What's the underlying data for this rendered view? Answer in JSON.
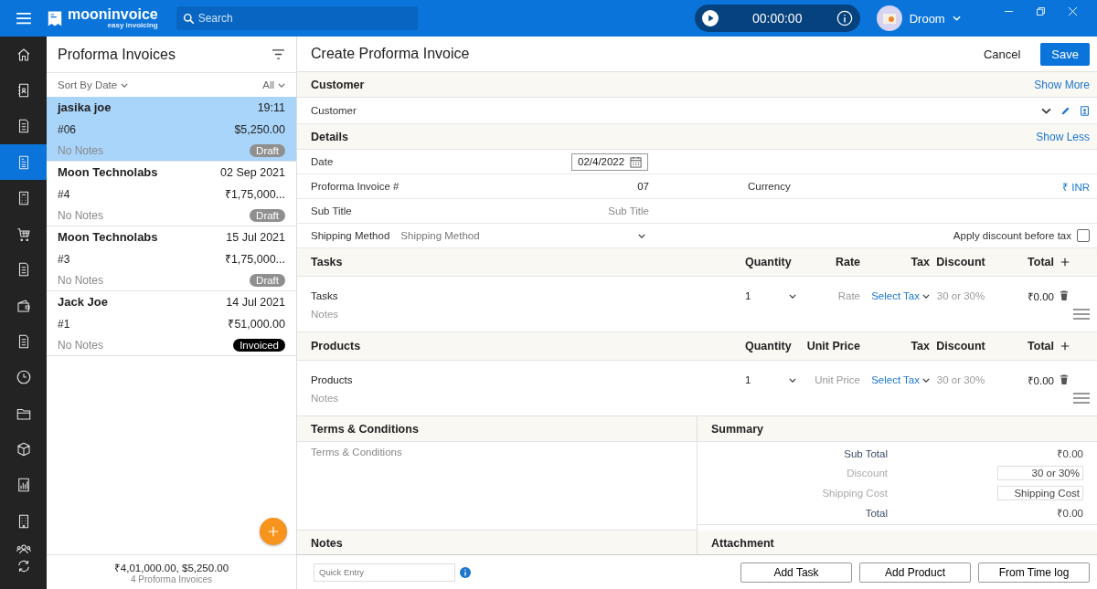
{
  "app": {
    "brand": "mooninvoice",
    "tagline": "easy invoicing",
    "search_placeholder": "Search",
    "timer": "00:00:00",
    "user": "Droom"
  },
  "sidebar": {
    "items": [
      {
        "selected": false
      },
      {
        "selected": false
      },
      {
        "selected": false
      },
      {
        "selected": true
      },
      {
        "selected": false
      },
      {
        "selected": false
      },
      {
        "selected": false
      },
      {
        "selected": false
      },
      {
        "selected": false
      },
      {
        "selected": false
      },
      {
        "selected": false
      },
      {
        "selected": false
      },
      {
        "selected": false
      },
      {
        "selected": false
      },
      {
        "selected": false
      },
      {
        "selected": false
      }
    ]
  },
  "list": {
    "title": "Proforma Invoices",
    "sort": "Sort By Date",
    "filter": "All",
    "items": [
      {
        "name": "jasika joe",
        "date": "19:11",
        "number": "#06",
        "amount": "$5,250.00",
        "notes": "No Notes",
        "status": "Draft",
        "kind": "draft",
        "selected": true
      },
      {
        "name": "Moon Technolabs",
        "date": "02 Sep 2021",
        "number": "#4",
        "amount": "₹1,75,000...",
        "notes": "No Notes",
        "status": "Draft",
        "kind": "draft",
        "selected": false
      },
      {
        "name": "Moon Technolabs",
        "date": "15 Jul 2021",
        "number": "#3",
        "amount": "₹1,75,000...",
        "notes": "No Notes",
        "status": "Draft",
        "kind": "draft",
        "selected": false
      },
      {
        "name": "Jack Joe",
        "date": "14 Jul 2021",
        "number": "#1",
        "amount": "₹51,000.00",
        "notes": "No Notes",
        "status": "Invoiced",
        "kind": "invoiced",
        "selected": false
      }
    ],
    "totals": "₹4,01,000.00, $5,250.00",
    "count": "4 Proforma Invoices"
  },
  "form": {
    "title": "Create Proforma Invoice",
    "cancel": "Cancel",
    "save": "Save",
    "customer": {
      "heading": "Customer",
      "toggle": "Show More",
      "placeholder": "Customer"
    },
    "details": {
      "heading": "Details",
      "toggle": "Show Less",
      "date_label": "Date",
      "date": "02/4/2022",
      "number_label": "Proforma Invoice #",
      "number": "07",
      "currency_label": "Currency",
      "currency": "₹ INR",
      "subtitle_label": "Sub Title",
      "subtitle_placeholder": "Sub Title",
      "shipping_label": "Shipping Method",
      "shipping_placeholder": "Shipping Method",
      "discount_label": "Apply discount before tax",
      "discount_before_tax": false
    },
    "sections": [
      {
        "heading": "Tasks",
        "columns": [
          "Quantity",
          "Rate",
          "Tax",
          "Discount",
          "Total"
        ],
        "row": {
          "name": "Tasks",
          "quantity": "1",
          "price_placeholder": "Rate",
          "tax": "Select Tax",
          "discount_placeholder": "30 or 30%",
          "total": "₹0.00",
          "notes_placeholder": "Notes"
        }
      },
      {
        "heading": "Products",
        "columns": [
          "Quantity",
          "Unit Price",
          "Tax",
          "Discount",
          "Total"
        ],
        "row": {
          "name": "Products",
          "quantity": "1",
          "price_placeholder": "Unit Price",
          "tax": "Select Tax",
          "discount_placeholder": "30 or 30%",
          "total": "₹0.00",
          "notes_placeholder": "Notes"
        }
      }
    ],
    "terms": {
      "heading": "Terms & Conditions",
      "placeholder": "Terms & Conditions"
    },
    "summary": {
      "heading": "Summary",
      "rows": [
        {
          "label": "Sub Total",
          "kind": "value",
          "value": "₹0.00"
        },
        {
          "label": "Discount",
          "kind": "input",
          "placeholder": "30 or 30%"
        },
        {
          "label": "Shipping Cost",
          "kind": "input",
          "placeholder": "Shipping Cost"
        },
        {
          "label": "Total",
          "kind": "value",
          "value": "₹0.00"
        }
      ]
    },
    "notes_heading": "Notes",
    "attachment_heading": "Attachment"
  },
  "footer": {
    "quick_entry_placeholder": "Quick Entry",
    "buttons": [
      "Add Task",
      "Add Product",
      "From Time log"
    ]
  }
}
